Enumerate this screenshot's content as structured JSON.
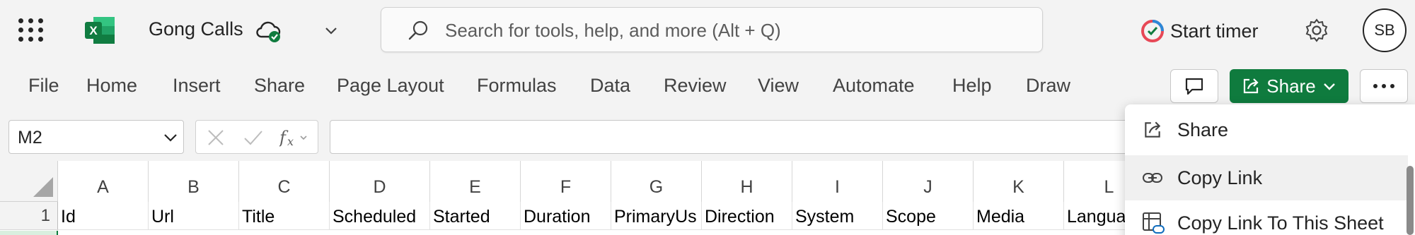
{
  "app": {
    "title": "Gong Calls",
    "search_placeholder": "Search for tools, help, and more (Alt + Q)",
    "timer_label": "Start timer",
    "user_initials": "SB",
    "accent_color": "#0f7b3e"
  },
  "ribbon": {
    "tabs": [
      "File",
      "Home",
      "Insert",
      "Share",
      "Page Layout",
      "Formulas",
      "Data",
      "Review",
      "View",
      "Automate",
      "Help",
      "Draw"
    ],
    "share_button_label": "Share"
  },
  "formula_bar": {
    "name_box": "M2",
    "formula": ""
  },
  "grid": {
    "columns": [
      "A",
      "B",
      "C",
      "D",
      "E",
      "F",
      "G",
      "H",
      "I",
      "J",
      "K",
      "L"
    ],
    "row_numbers": [
      "1"
    ],
    "rows": [
      [
        "Id",
        "Url",
        "Title",
        "Scheduled",
        "Started",
        "Duration",
        "PrimaryUs",
        "Direction",
        "System",
        "Scope",
        "Media",
        "Langua"
      ]
    ]
  },
  "share_menu": {
    "items": [
      {
        "label": "Share",
        "icon": "share-icon"
      },
      {
        "label": "Copy Link",
        "icon": "link-icon"
      },
      {
        "label": "Copy Link To This Sheet",
        "icon": "sheet-link-icon"
      }
    ]
  }
}
